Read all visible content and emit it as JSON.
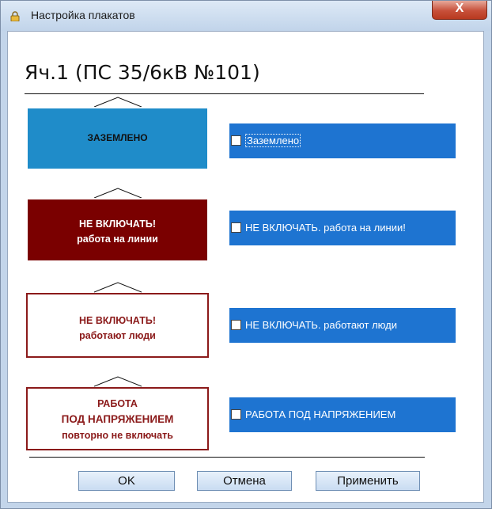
{
  "window": {
    "title": "Настройка плакатов",
    "close_label": "X"
  },
  "cell_title": "Яч.1 (ПС 35/6кВ №101)",
  "signs": [
    {
      "lines": [
        "ЗАЗЕМЛЕНО"
      ],
      "bg": "#1f8cc9",
      "border": "#ffffff",
      "color": "#111111"
    },
    {
      "lines": [
        "НЕ ВКЛЮЧАТЬ!",
        "работа на линии"
      ],
      "bg": "#7a0000",
      "border": "#ffffff",
      "color": "#ffffff"
    },
    {
      "lines": [
        "НЕ ВКЛЮЧАТЬ!",
        "работают люди"
      ],
      "bg": "#ffffff",
      "border": "#8b1a1a",
      "color": "#8b1a1a"
    },
    {
      "lines": [
        "РАБОТА",
        "ПОД НАПРЯЖЕНИЕМ",
        "повторно не включать"
      ],
      "bg": "#ffffff",
      "border": "#8b1a1a",
      "color": "#8b1a1a"
    }
  ],
  "options": [
    {
      "label": "Заземлено",
      "checked": false
    },
    {
      "label": "НЕ ВКЛЮЧАТЬ. работа на линии!",
      "checked": false
    },
    {
      "label": "НЕ ВКЛЮЧАТЬ. работают люди",
      "checked": false
    },
    {
      "label": "РАБОТА ПОД НАПРЯЖЕНИЕМ",
      "checked": false
    }
  ],
  "buttons": {
    "ok": "OK",
    "cancel": "Отмена",
    "apply": "Применить"
  },
  "colors": {
    "option_bg": "#1e74d1",
    "window_frame": "#c3d5ea"
  }
}
